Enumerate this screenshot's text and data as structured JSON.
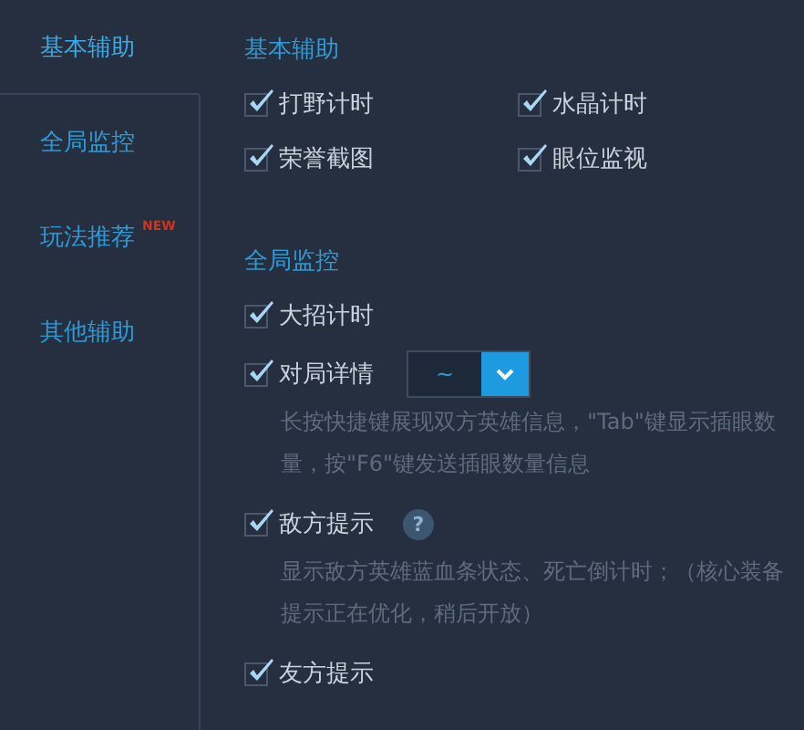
{
  "sidebar": {
    "items": [
      {
        "label": "基本辅助",
        "selected": true
      },
      {
        "label": "全局监控",
        "selected": false
      },
      {
        "label": "玩法推荐",
        "selected": false,
        "badge": "NEW"
      },
      {
        "label": "其他辅助",
        "selected": false
      }
    ]
  },
  "sections": [
    {
      "title": "基本辅助",
      "options": [
        {
          "kind": "check",
          "label": "打野计时",
          "checked": true
        },
        {
          "kind": "check",
          "label": "水晶计时",
          "checked": true
        },
        {
          "kind": "check",
          "label": "荣誉截图",
          "checked": true
        },
        {
          "kind": "check",
          "label": "眼位监视",
          "checked": true
        }
      ]
    },
    {
      "title": "全局监控",
      "options": [
        {
          "kind": "check",
          "label": "大招计时",
          "checked": true
        },
        {
          "kind": "dropdown",
          "label": "对局详情",
          "checked": true,
          "value": "~",
          "description": "长按快捷键展现双方英雄信息，\"Tab\"键显示插眼数量，按\"F6\"键发送插眼数量信息"
        },
        {
          "kind": "help",
          "label": "敌方提示",
          "checked": true,
          "help": "?",
          "description": "显示敌方英雄蓝血条状态、死亡倒计时；（核心装备提示正在优化，稍后开放）"
        },
        {
          "kind": "check",
          "label": "友方提示",
          "checked": true
        }
      ]
    }
  ]
}
